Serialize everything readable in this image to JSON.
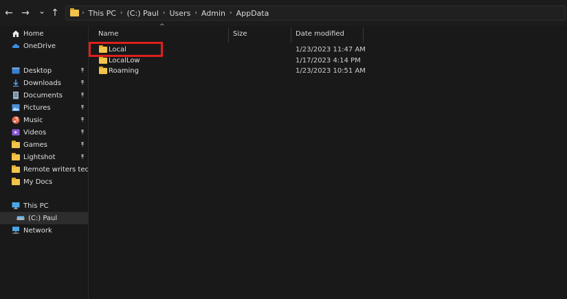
{
  "nav": {
    "back_glyph": "←",
    "forward_glyph": "→",
    "dropdown_glyph": "⌄",
    "up_glyph": "↑"
  },
  "address_bar": {
    "crumbs": [
      "This PC",
      "(C:) Paul",
      "Users",
      "Admin",
      "AppData"
    ],
    "separator": "›"
  },
  "sidebar": {
    "items": [
      {
        "label": "Home",
        "icon": "home-icon",
        "pinned": false
      },
      {
        "label": "OneDrive",
        "icon": "cloud-icon",
        "pinned": false
      },
      {
        "label": "Desktop",
        "icon": "desktop-icon",
        "pinned": true
      },
      {
        "label": "Downloads",
        "icon": "download-icon",
        "pinned": true
      },
      {
        "label": "Documents",
        "icon": "document-icon",
        "pinned": true
      },
      {
        "label": "Pictures",
        "icon": "picture-icon",
        "pinned": true
      },
      {
        "label": "Music",
        "icon": "music-icon",
        "pinned": true
      },
      {
        "label": "Videos",
        "icon": "video-icon",
        "pinned": true
      },
      {
        "label": "Games",
        "icon": "folder-icon",
        "pinned": true
      },
      {
        "label": "Lightshot",
        "icon": "folder-icon",
        "pinned": true
      },
      {
        "label": "Remote writers tech",
        "icon": "folder-icon",
        "pinned": true
      },
      {
        "label": "My Docs",
        "icon": "folder-icon",
        "pinned": false
      },
      {
        "label": "This PC",
        "icon": "computer-icon",
        "pinned": false
      },
      {
        "label": "(C:) Paul",
        "icon": "drive-icon",
        "pinned": false,
        "selected": true
      },
      {
        "label": "Network",
        "icon": "network-icon",
        "pinned": false
      }
    ],
    "pin_glyph": "📌"
  },
  "columns": {
    "name": "Name",
    "size": "Size",
    "date_modified": "Date modified",
    "sort_glyph": "^"
  },
  "files": [
    {
      "name": "Local",
      "date": "1/23/2023 11:47 AM",
      "highlighted": true
    },
    {
      "name": "LocalLow",
      "date": "1/17/2023 4:14 PM",
      "highlighted": false
    },
    {
      "name": "Roaming",
      "date": "1/23/2023 10:51 AM",
      "highlighted": false
    }
  ],
  "colors": {
    "background": "#191919",
    "folder": "#f2c44b",
    "highlight_border": "#e0201c",
    "selected_row": "#2d2d2d"
  }
}
